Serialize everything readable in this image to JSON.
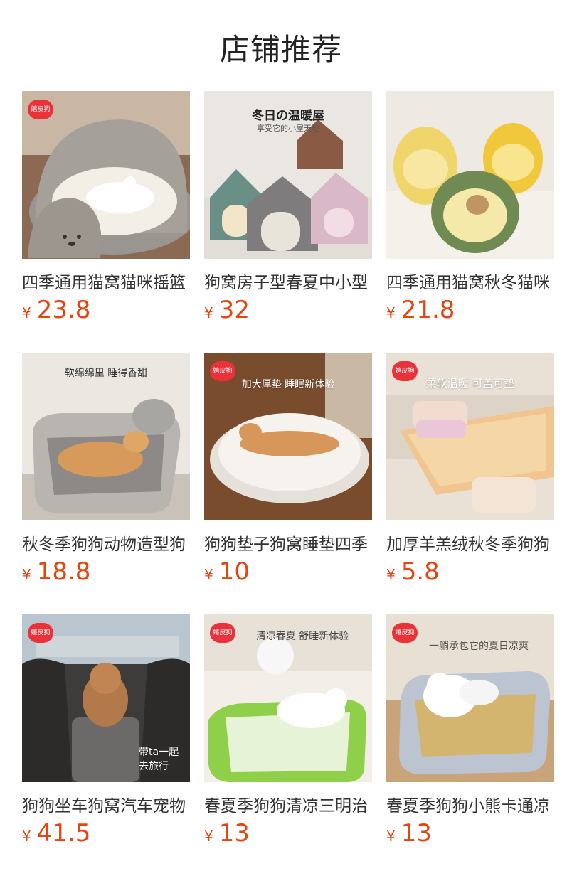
{
  "page": {
    "title": "店铺推荐"
  },
  "products": [
    {
      "name": "四季通用猫窝猫咪摇篮",
      "currency": "¥",
      "price": "23.8",
      "logo": "嬉皮狗",
      "overlay": ""
    },
    {
      "name": "狗窝房子型春夏中小型",
      "currency": "¥",
      "price": "32",
      "logo": "",
      "overlay": "冬日の温暖屋",
      "overlay2": "享受它的小屋天地"
    },
    {
      "name": "四季通用猫窝秋冬猫咪",
      "currency": "¥",
      "price": "21.8",
      "logo": "",
      "overlay": ""
    },
    {
      "name": "秋冬季狗狗动物造型狗",
      "currency": "¥",
      "price": "18.8",
      "logo": "",
      "overlay": "软绵绵里 睡得香甜"
    },
    {
      "name": "狗狗垫子狗窝睡垫四季",
      "currency": "¥",
      "price": "10",
      "logo": "嬉皮狗",
      "overlay": "加大厚垫 睡眠新体验"
    },
    {
      "name": "加厚羊羔绒秋冬季狗狗",
      "currency": "¥",
      "price": "5.8",
      "logo": "嬉皮狗",
      "overlay": "柔软温暖  可盖可垫"
    },
    {
      "name": "狗狗坐车狗窝汽车宠物",
      "currency": "¥",
      "price": "41.5",
      "logo": "嬉皮狗",
      "overlay": "",
      "overlay_side": "带ta一起\n去旅行"
    },
    {
      "name": "春夏季狗狗清凉三明治",
      "currency": "¥",
      "price": "13",
      "logo": "嬉皮狗",
      "overlay": "清凉春夏 舒睡新体验"
    },
    {
      "name": "春夏季狗狗小熊卡通凉",
      "currency": "¥",
      "price": "13",
      "logo": "嬉皮狗",
      "overlay": "一躺承包它的夏日凉爽"
    }
  ],
  "colors": {
    "price": "#e64411",
    "logo_bg": "#e9323a",
    "title": "#222222"
  }
}
